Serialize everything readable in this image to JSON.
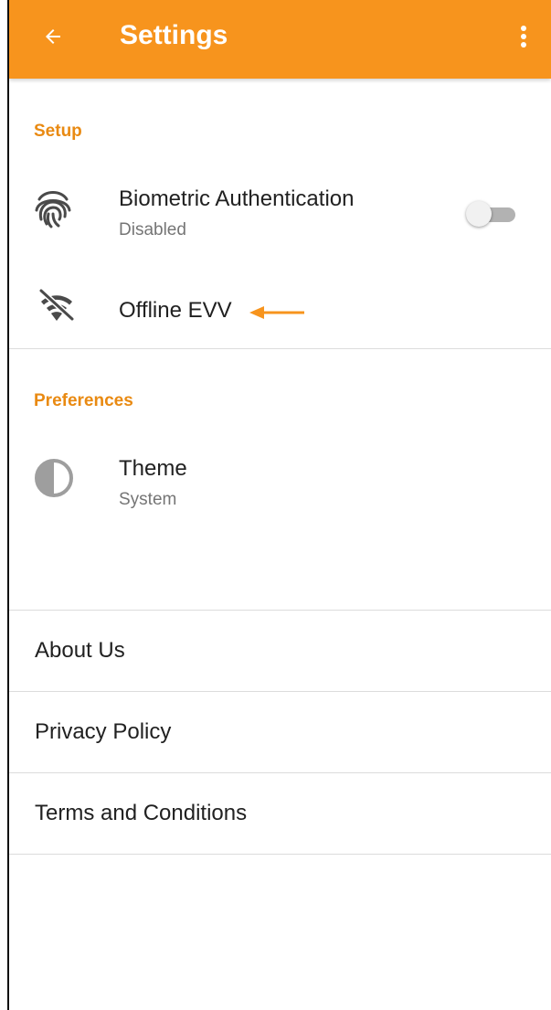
{
  "colors": {
    "app_bar": "#f7941d",
    "accent": "#e98a12",
    "divider": "#dcdcdc",
    "secondary_text": "#757575"
  },
  "app_bar": {
    "title": "Settings",
    "back_icon": "arrow-back-icon",
    "menu_icon": "more-vert-icon"
  },
  "setup": {
    "header": "Setup",
    "biometric": {
      "title": "Biometric Authentication",
      "status": "Disabled",
      "icon": "fingerprint-icon",
      "enabled": false
    },
    "offline_evv": {
      "title": "Offline EVV",
      "icon": "wifi-off-icon"
    }
  },
  "preferences": {
    "header": "Preferences",
    "theme": {
      "title": "Theme",
      "value": "System",
      "icon": "half-circle-theme-icon"
    }
  },
  "links": [
    {
      "label": "About Us"
    },
    {
      "label": "Privacy Policy"
    },
    {
      "label": "Terms and Conditions"
    }
  ]
}
